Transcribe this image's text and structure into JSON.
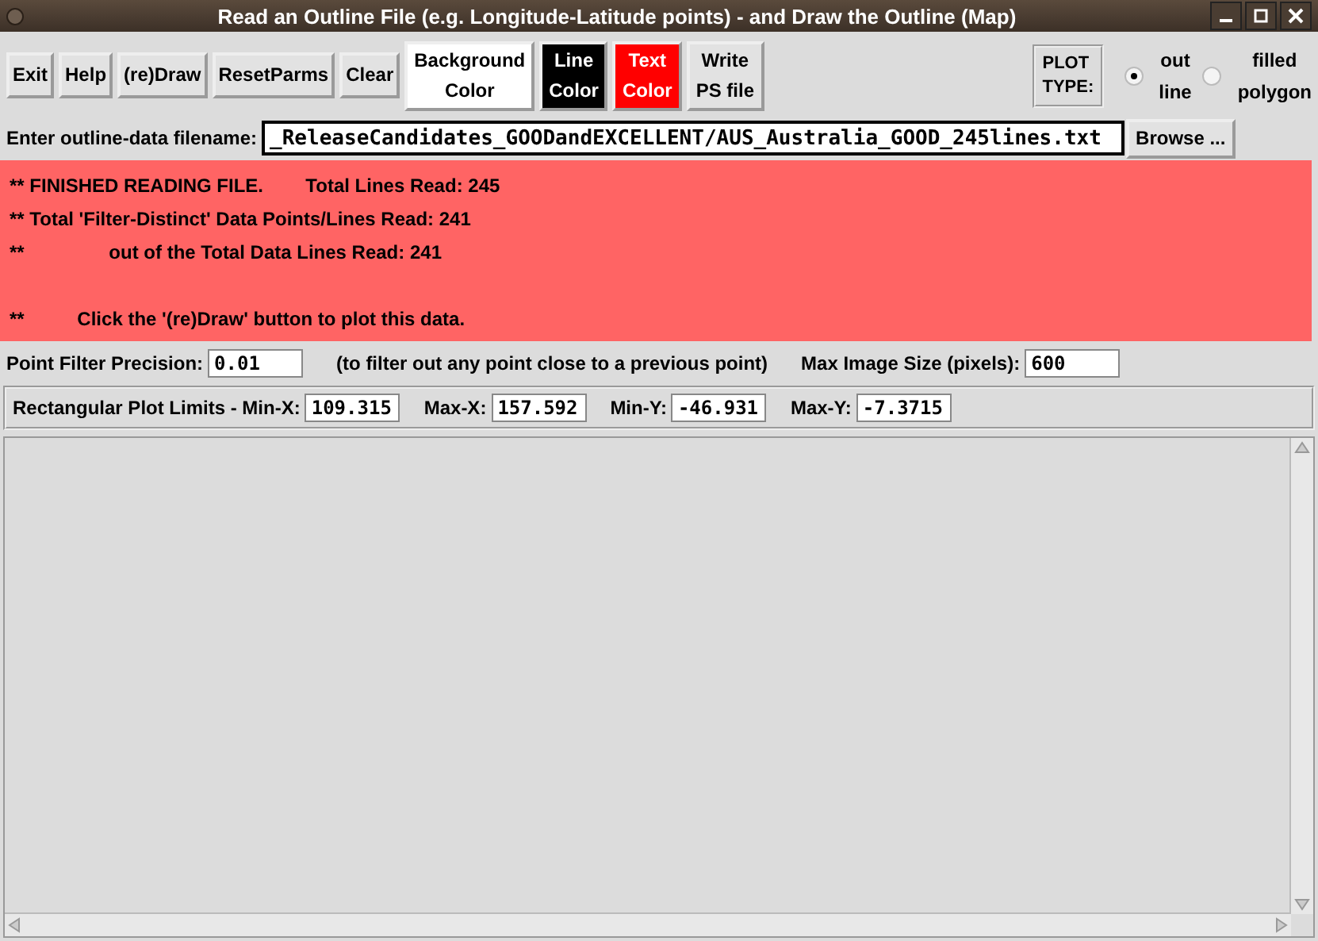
{
  "window": {
    "title": "Read an Outline File (e.g. Longitude-Latitude points) - and Draw the Outline (Map)"
  },
  "toolbar": [
    {
      "label": "Exit",
      "kind": "action"
    },
    {
      "label": "Help",
      "kind": "action"
    },
    {
      "label": "(re)Draw",
      "kind": "action"
    },
    {
      "label": "ResetParms",
      "kind": "action"
    },
    {
      "label": "Clear",
      "kind": "action"
    },
    {
      "label": "Background\nColor",
      "kind": "color",
      "color": "#ffffff"
    },
    {
      "label": "Line\nColor",
      "kind": "color",
      "color": "#000000"
    },
    {
      "label": "Text\nColor",
      "kind": "color",
      "color": "#ff0000"
    },
    {
      "label": "Write\nPS file",
      "kind": "action"
    }
  ],
  "plot_type": {
    "label": "PLOT\nTYPE:",
    "options": [
      {
        "label": "out\nline",
        "selected": true
      },
      {
        "label": "filled\npolygon",
        "selected": false
      }
    ]
  },
  "filename": {
    "label": "Enter outline-data filename:",
    "value": "_ReleaseCandidates_GOODandEXCELLENT/AUS_Australia_GOOD_245lines.txt",
    "browse": "Browse ..."
  },
  "message": "** FINISHED READING FILE.        Total Lines Read: 245\n** Total 'Filter-Distinct' Data Points/Lines Read: 241\n**                out of the Total Data Lines Read: 241\n\n**          Click the '(re)Draw' button to plot this data.",
  "filter": {
    "label": "Point Filter Precision:",
    "value": "0.01",
    "note": "(to filter out any point close to a previous point)",
    "size_label": "Max Image Size (pixels):",
    "size_value": "600"
  },
  "limits": [
    {
      "label": "Rectangular Plot Limits - Min-X:",
      "value": "109.315"
    },
    {
      "label": "Max-X:",
      "value": "157.592"
    },
    {
      "label": "Min-Y:",
      "value": "-46.931"
    },
    {
      "label": "Max-Y:",
      "value": "-7.3715"
    }
  ]
}
